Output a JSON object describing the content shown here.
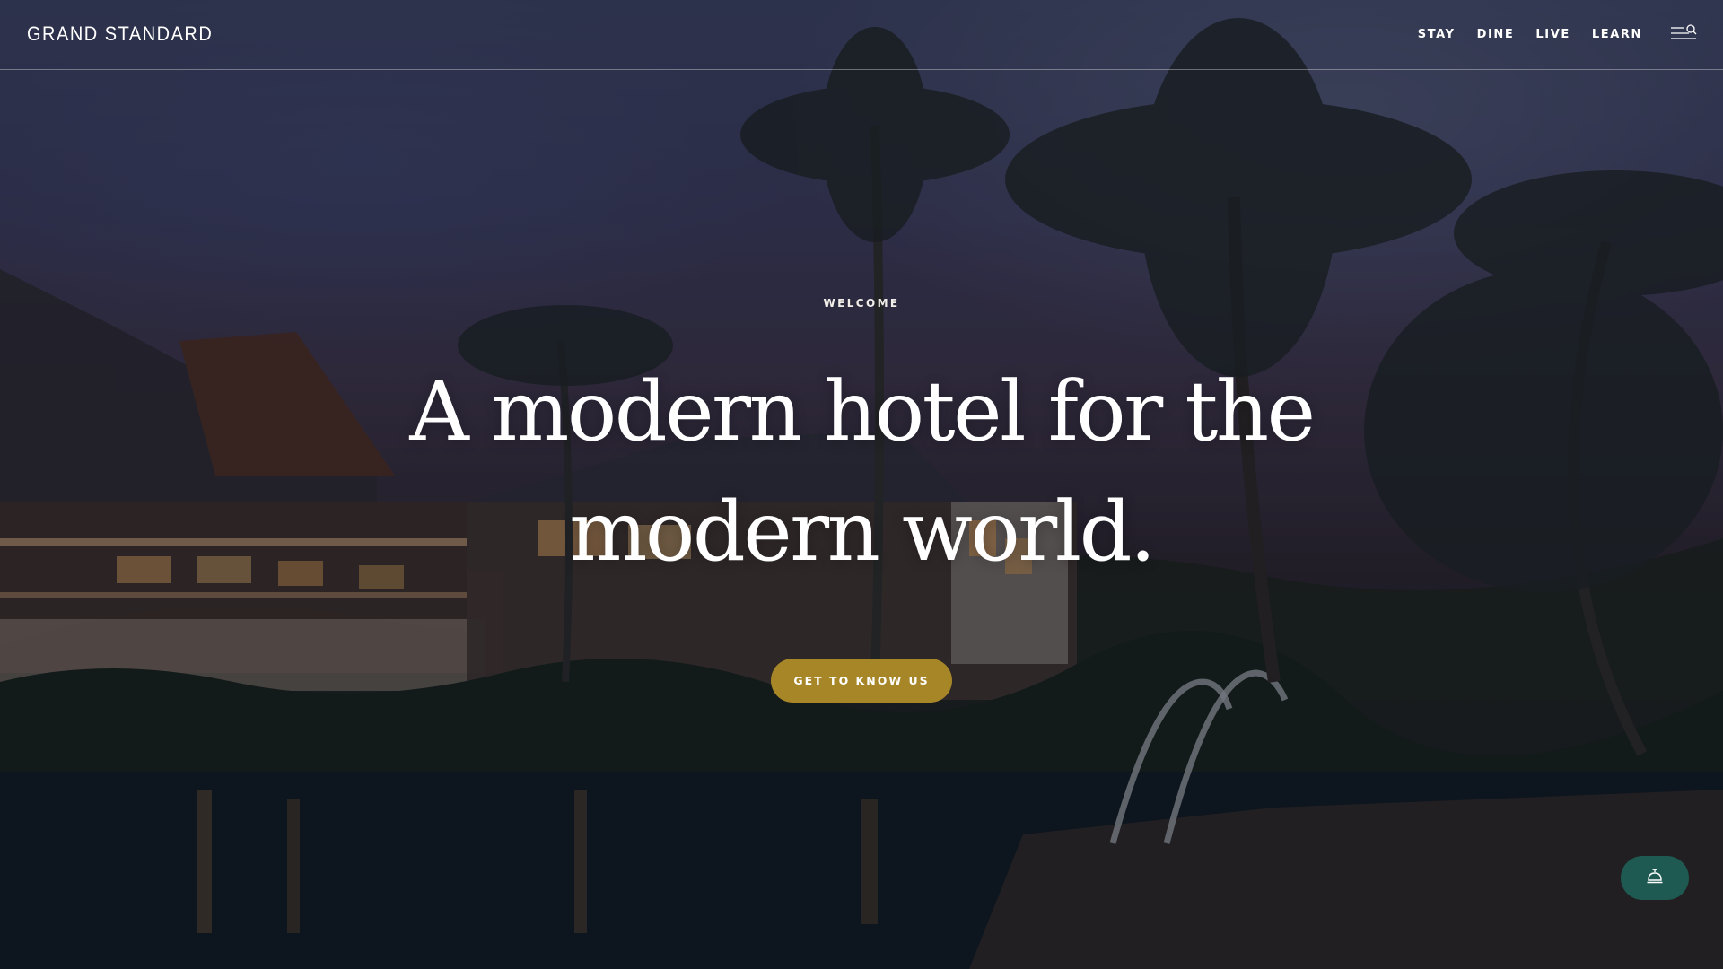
{
  "header": {
    "logo": "GRAND STANDARD",
    "nav": [
      {
        "label": "STAY"
      },
      {
        "label": "DINE"
      },
      {
        "label": "LIVE"
      },
      {
        "label": "LEARN"
      }
    ],
    "menu_icon": "menu-search-icon"
  },
  "hero": {
    "eyebrow": "WELCOME",
    "headline_line1": "A modern hotel for the",
    "headline_line2": "modern world.",
    "cta_label": "GET TO KNOW US"
  },
  "concierge": {
    "icon": "concierge-bell-icon"
  },
  "colors": {
    "cta": "#a78628",
    "concierge": "#1f5a52",
    "text": "#ffffff"
  }
}
